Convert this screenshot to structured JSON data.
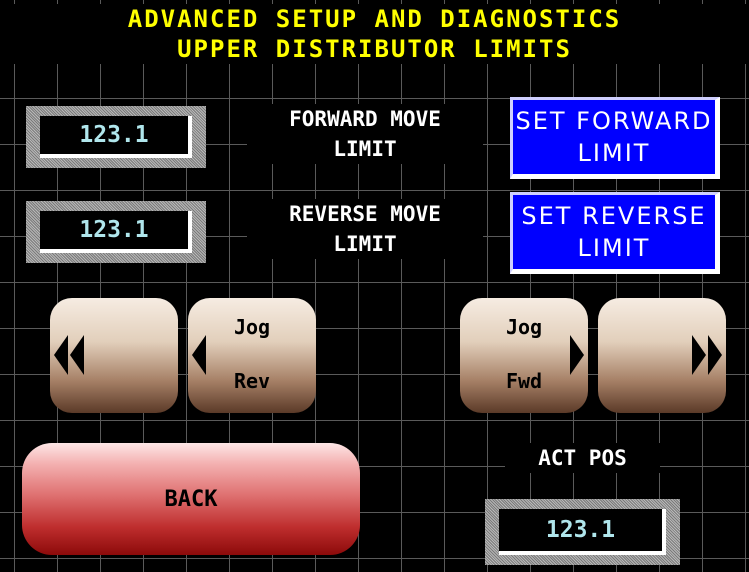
{
  "header": {
    "line1": "ADVANCED SETUP AND DIAGNOSTICS",
    "line2": "UPPER DISTRIBUTOR LIMITS"
  },
  "forward": {
    "value": "123.1",
    "label_line1": "FORWARD MOVE",
    "label_line2": "LIMIT",
    "button_line1": "SET FORWARD",
    "button_line2": "LIMIT"
  },
  "reverse": {
    "value": "123.1",
    "label_line1": "REVERSE MOVE",
    "label_line2": "LIMIT",
    "button_line1": "SET REVERSE",
    "button_line2": "LIMIT"
  },
  "jog": {
    "rev_line1": "Jog",
    "rev_line2": "Rev",
    "fwd_line1": "Jog",
    "fwd_line2": "Fwd"
  },
  "position": {
    "label": "ACT POS",
    "value": "123.1"
  },
  "back_label": "BACK",
  "colors": {
    "title": "#ffff00",
    "value_text": "#b0e6ec",
    "set_button": "#0000ff",
    "back_button": "#c83232",
    "grid": "#5a5a5a"
  }
}
